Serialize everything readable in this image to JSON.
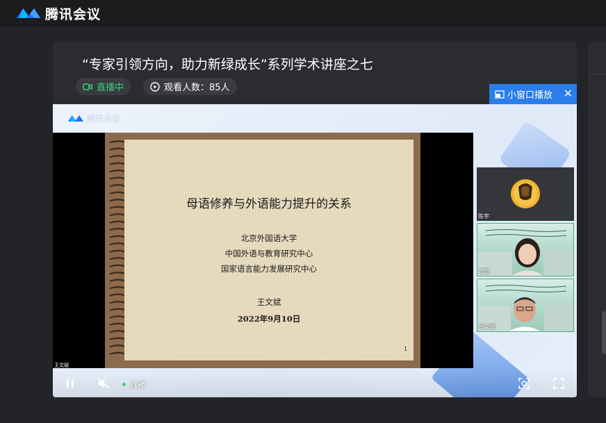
{
  "app": {
    "name": "腾讯会议"
  },
  "event": {
    "title": "“专家引领方向，助力新绿成长”系列学术讲座之七",
    "live_label": "直播中",
    "viewers_label": "观看人数：85人"
  },
  "mini_window": {
    "label": "小窗口播放",
    "close": "✕"
  },
  "video": {
    "watermark": "腾讯会议",
    "slide": {
      "title": "母语修养与外语能力提升的关系",
      "orgs": [
        "北京外国语大学",
        "中国外语与教育研究中心",
        "国家语言能力发展研究中心"
      ],
      "speaker": "王文斌",
      "date": "2022年9月10日",
      "page": "1"
    },
    "speaker_label": "王文斌",
    "participants": [
      {
        "name": "陈宇"
      },
      {
        "name": "李芝"
      },
      {
        "name": "王文斌"
      }
    ],
    "live_indicator": "直播"
  },
  "colors": {
    "accent": "#2b7de9",
    "live": "#3ccf7a"
  },
  "icons": [
    "camera-icon",
    "play-circle-icon",
    "mini-window-icon",
    "close-icon",
    "pause-icon",
    "mute-icon",
    "screenshot-icon",
    "fullscreen-icon"
  ]
}
